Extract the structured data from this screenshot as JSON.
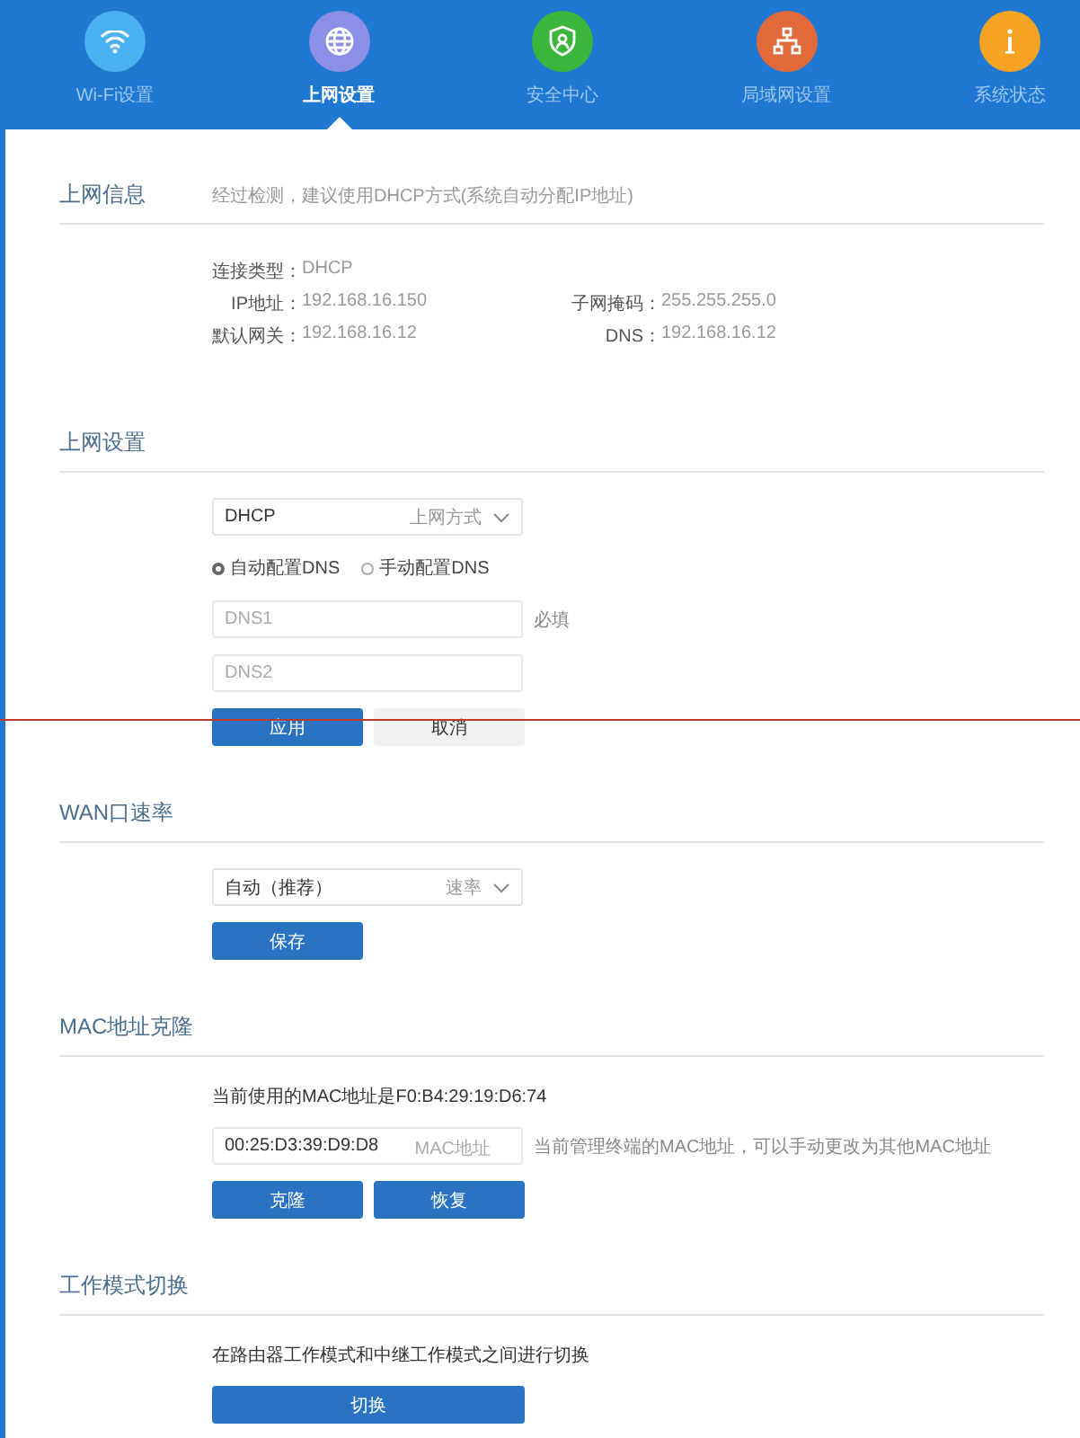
{
  "nav": [
    {
      "label": "Wi-Fi设置",
      "selected": false,
      "color": "#4bb2f2"
    },
    {
      "label": "上网设置",
      "selected": true,
      "color": "#8b8fe6"
    },
    {
      "label": "安全中心",
      "selected": false,
      "color": "#3cb53c"
    },
    {
      "label": "局域网设置",
      "selected": false,
      "color": "#e2693a"
    },
    {
      "label": "系统状态",
      "selected": false,
      "color": "#f5a322"
    }
  ],
  "sections": [
    {
      "title": "上网信息",
      "hint": "经过检测，建议使用DHCP方式(系统自动分配IP地址)",
      "items": [
        {
          "kind": "info",
          "cells": [
            {
              "label": "连接类型：",
              "value": "DHCP"
            }
          ]
        },
        {
          "kind": "info",
          "cells": [
            {
              "label": "IP地址：",
              "value": "192.168.16.150"
            },
            {
              "label": "子网掩码：",
              "value": "255.255.255.0"
            }
          ]
        },
        {
          "kind": "info",
          "cells": [
            {
              "label": "默认网关：",
              "value": "192.168.16.12"
            },
            {
              "label": "DNS：",
              "value": "192.168.16.12"
            }
          ]
        }
      ]
    },
    {
      "title": "上网设置",
      "items": [
        {
          "kind": "select",
          "value": "DHCP",
          "label": "上网方式"
        },
        {
          "kind": "radios",
          "options": [
            {
              "label": "自动配置DNS",
              "selected": true
            },
            {
              "label": "手动配置DNS",
              "selected": false
            }
          ]
        },
        {
          "kind": "field",
          "placeholder": "DNS1",
          "note": "必填"
        },
        {
          "kind": "field",
          "placeholder": "DNS2"
        },
        {
          "kind": "buttons",
          "buttons": [
            {
              "label": "应用",
              "kind": "primary"
            },
            {
              "label": "取消",
              "kind": "secondary"
            }
          ]
        }
      ]
    },
    {
      "title": "WAN口速率",
      "items": [
        {
          "kind": "select",
          "value": "自动（推荐）",
          "label": "速率"
        },
        {
          "kind": "buttons",
          "buttons": [
            {
              "label": "保存",
              "kind": "primary"
            }
          ]
        }
      ]
    },
    {
      "title": "MAC地址克隆",
      "items": [
        {
          "kind": "text",
          "text": "当前使用的MAC地址是F0:B4:29:19:D6:74"
        },
        {
          "kind": "field",
          "value": "00:25:D3:39:D9:D8",
          "suffix": "MAC地址",
          "note": "当前管理终端的MAC地址，可以手动更改为其他MAC地址"
        },
        {
          "kind": "buttons",
          "buttons": [
            {
              "label": "克隆",
              "kind": "primary"
            },
            {
              "label": "恢复",
              "kind": "primary"
            }
          ]
        }
      ]
    },
    {
      "title": "工作模式切换",
      "items": [
        {
          "kind": "text",
          "text": "在路由器工作模式和中继工作模式之间进行切换"
        },
        {
          "kind": "wide-button",
          "buttons": [
            {
              "label": "切换",
              "kind": "primary"
            }
          ]
        }
      ]
    }
  ]
}
